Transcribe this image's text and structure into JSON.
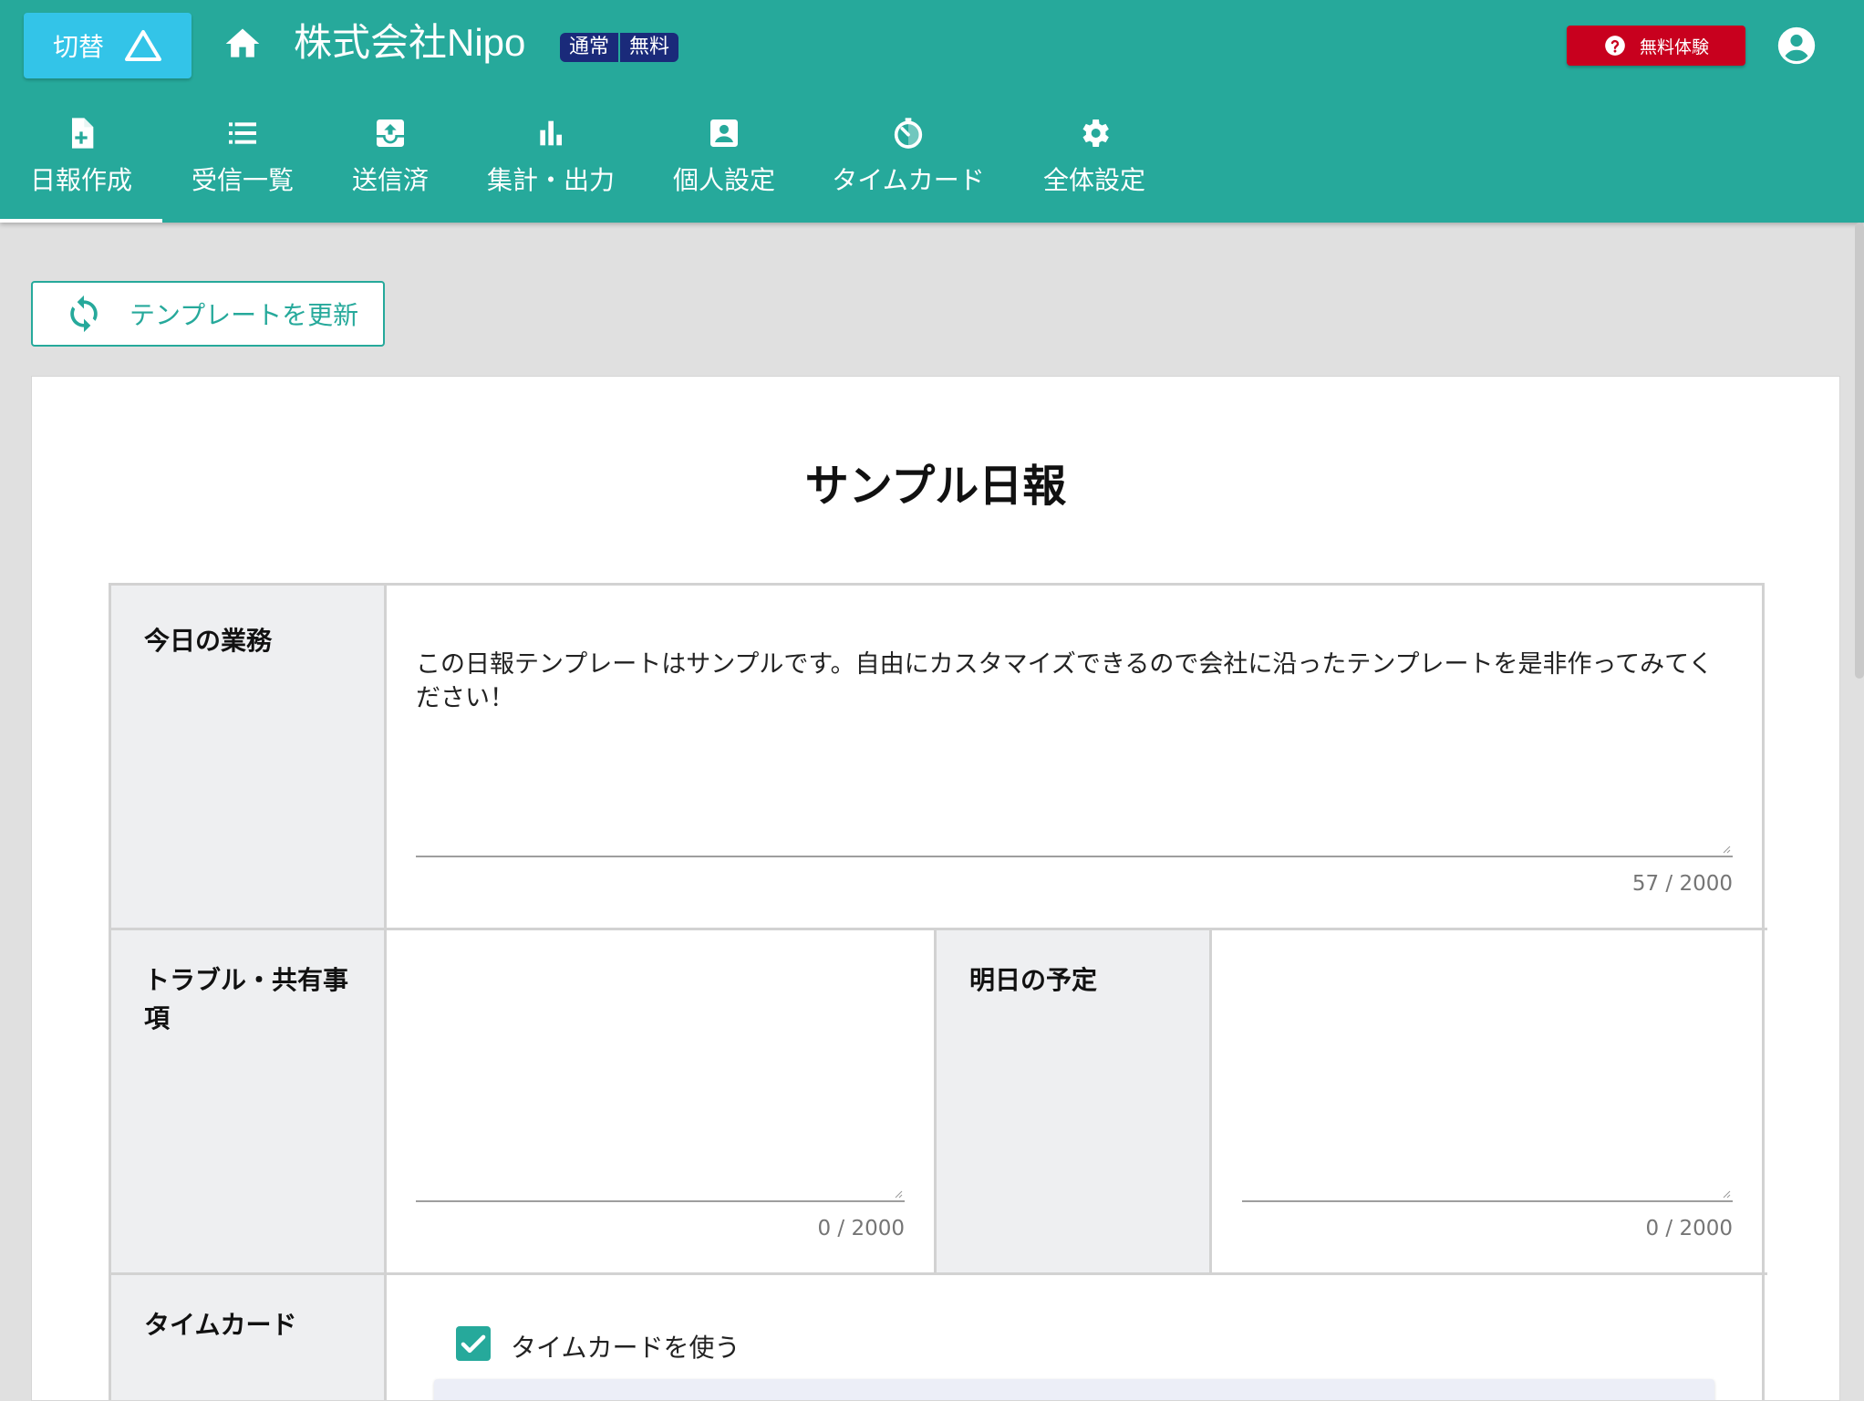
{
  "header": {
    "switch_label": "切替",
    "company_name": "株式会社Nipo",
    "plan_badges": [
      "通常",
      "無料"
    ],
    "trial_label": "無料体験"
  },
  "tabs": [
    {
      "label": "日報作成",
      "icon": "file-plus-icon",
      "active": true
    },
    {
      "label": "受信一覧",
      "icon": "list-icon",
      "active": false
    },
    {
      "label": "送信済",
      "icon": "outbox-icon",
      "active": false
    },
    {
      "label": "集計・出力",
      "icon": "bar-chart-icon",
      "active": false
    },
    {
      "label": "個人設定",
      "icon": "account-box-icon",
      "active": false
    },
    {
      "label": "タイムカード",
      "icon": "timer-icon",
      "active": false
    },
    {
      "label": "全体設定",
      "icon": "gear-icon",
      "active": false
    }
  ],
  "toolbar": {
    "refresh_label": "テンプレートを更新"
  },
  "report": {
    "title": "サンプル日報",
    "fields": {
      "today": {
        "label": "今日の業務",
        "value": "この日報テンプレートはサンプルです。自由にカスタマイズできるので会社に沿ったテンプレートを是非作ってみてください！",
        "counter": "57 / 2000"
      },
      "trouble": {
        "label": "トラブル・共有事項",
        "value": "",
        "counter": "0 / 2000"
      },
      "tomorrow": {
        "label": "明日の予定",
        "value": "",
        "counter": "0 / 2000"
      },
      "timecard": {
        "label": "タイムカード",
        "checkbox_label": "タイムカードを使う",
        "checked": true
      }
    }
  },
  "colors": {
    "primary": "#26a99b",
    "switch": "#33c4e8",
    "badge": "#1a2a7a",
    "trial": "#c8001e"
  }
}
